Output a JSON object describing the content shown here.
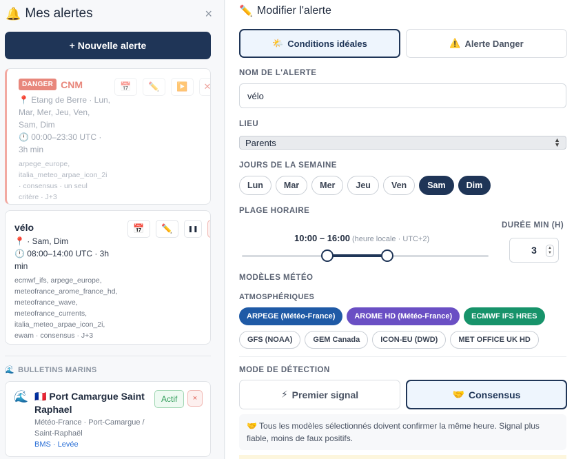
{
  "sidebar": {
    "title": "Mes alertes",
    "new_alert_label": "+ Nouvelle alerte",
    "close_glyph": "×",
    "danger_card": {
      "badge": "DANGER",
      "name": "CNM",
      "location_line1": "📍 Etang de Berre · Lun,",
      "location_line2": "Mar, Mer, Jeu, Ven,",
      "location_line3": "Sam, Dim",
      "time_line1": "🕛 00:00–23:30 UTC ·",
      "time_line2": "3h min",
      "models_line1": "arpege_europe,",
      "models_line2": "italia_meteo_arpae_icon_2i",
      "models_line3": "· consensus · un seul",
      "models_line4": "critère · J+3"
    },
    "velo_card": {
      "name": "vélo",
      "location_line": "📍 · Sam, Dim",
      "time_line1": "🕛 08:00–14:00 UTC · 3h",
      "time_line2": "min",
      "models_line1": "ecmwf_ifs, arpege_europe,",
      "models_line2": "meteofrance_arome_france_hd,",
      "models_line3": "meteofrance_wave,",
      "models_line4": "meteofrance_currents,",
      "models_line5": "italia_meteo_arpae_icon_2i,",
      "models_line6": "ewam · consensus · J+3"
    },
    "bulletins_heading": "BULLETINS MARINS",
    "port_card": {
      "name": "Port Camargue Saint Raphael",
      "sub": "Météo-France · Port-Camargue / Saint-Raphaël",
      "links": "BMS · Levée",
      "status": "Actif",
      "remove_glyph": "×"
    }
  },
  "main": {
    "title": "Modifier l'alerte",
    "type_tabs": [
      {
        "label": "Conditions idéales",
        "icon": "🌤️",
        "active": true
      },
      {
        "label": "Alerte Danger",
        "icon": "⚠️",
        "active": false
      }
    ],
    "name_label": "NOM DE L'ALERTE",
    "name_value": "vélo",
    "place_label": "LIEU",
    "place_value": "Parents",
    "days_label": "JOURS DE LA SEMAINE",
    "days": [
      {
        "label": "Lun",
        "on": false
      },
      {
        "label": "Mar",
        "on": false
      },
      {
        "label": "Mer",
        "on": false
      },
      {
        "label": "Jeu",
        "on": false
      },
      {
        "label": "Ven",
        "on": false
      },
      {
        "label": "Sam",
        "on": true
      },
      {
        "label": "Dim",
        "on": true
      }
    ],
    "time_label": "PLAGE HORAIRE",
    "time_range": "10:00 – 16:00",
    "time_note": "(heure locale · UTC+2)",
    "duration_label": "DURÉE MIN (H)",
    "duration_value": "3",
    "models_label": "MODÈLES MÉTÉO",
    "atmos_label": "ATMOSPHÉRIQUES",
    "models_row1": [
      {
        "label": "ARPEGE (Météo-France)",
        "on": true,
        "color": "#1f5aa6"
      },
      {
        "label": "AROME HD (Météo-France)",
        "on": true,
        "color": "#6a4fc4"
      },
      {
        "label": "ECMWF IFS HRES",
        "on": true,
        "color": "#17936a"
      }
    ],
    "models_row2": [
      {
        "label": "GFS (NOAA)",
        "on": false
      },
      {
        "label": "GEM Canada",
        "on": false
      },
      {
        "label": "ICON-EU (DWD)",
        "on": false
      },
      {
        "label": "MET OFFICE UK HD",
        "on": false
      }
    ],
    "mode_label": "MODE DE DÉTECTION",
    "mode_tabs": [
      {
        "label": "Premier signal",
        "icon": "⚡",
        "active": false
      },
      {
        "label": "Consensus",
        "icon": "🤝",
        "active": true
      }
    ],
    "mode_info": "🤝 Tous les modèles sélectionnés doivent confirmer la même heure. Signal plus fiable, moins de faux positifs."
  }
}
